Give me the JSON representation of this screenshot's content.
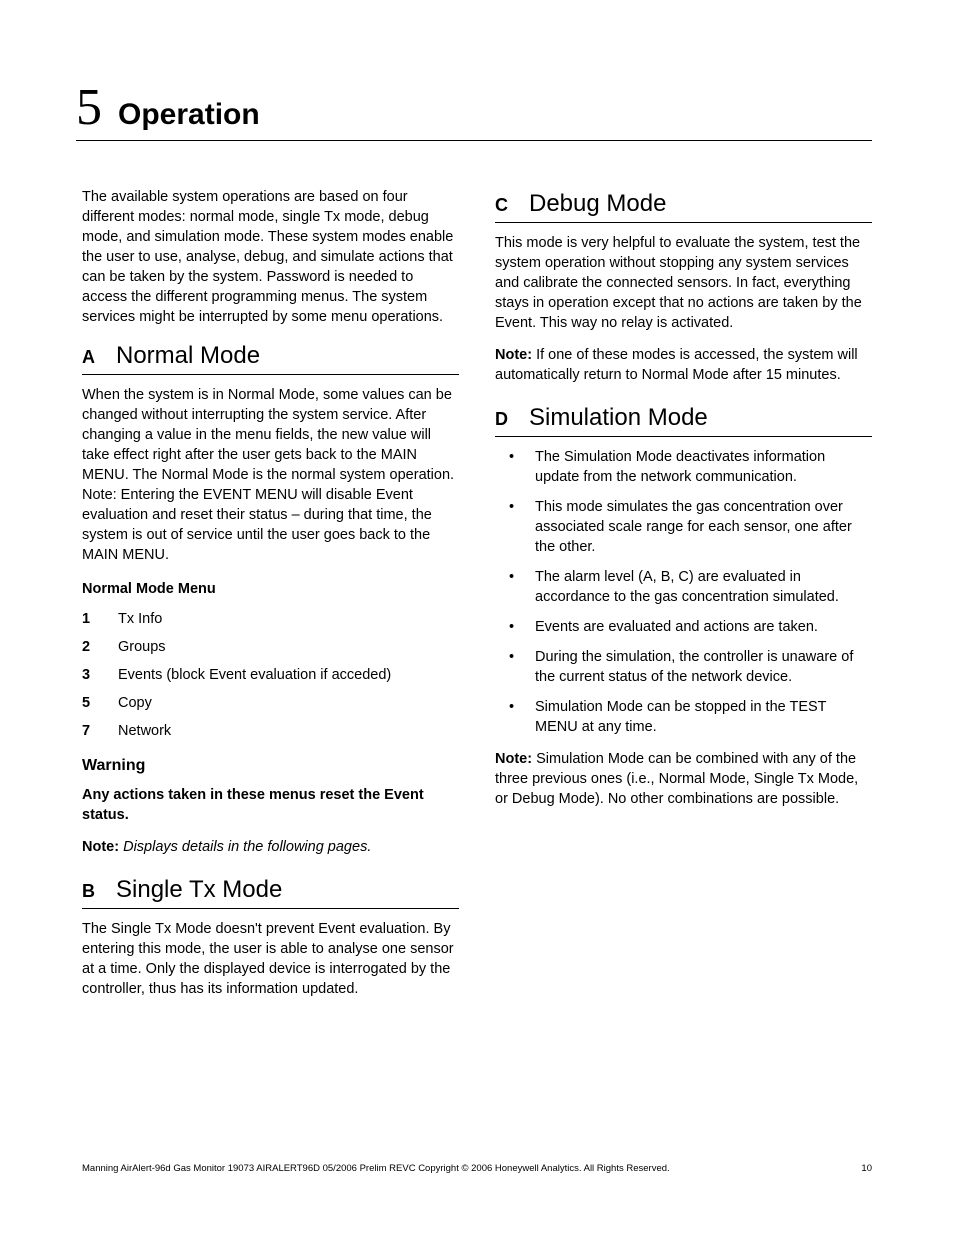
{
  "chapter": {
    "number": "5",
    "title": "Operation"
  },
  "intro": "The available system operations are based on four different modes: normal mode, single Tx mode, debug mode, and simulation mode. These system modes enable the user to use, analyse, debug, and simulate actions that can be taken by the system. Password is needed to access the different programming menus. The system services might be interrupted by some menu operations.",
  "sections": {
    "a": {
      "letter": "A",
      "title": "Normal Mode",
      "body": "When the system is in Normal Mode, some values can be changed without interrupting the system service. After changing a value in the menu fields, the new value will take effect right after the user gets back to the MAIN MENU. The Normal Mode is the normal system operation. Note: Entering the EVENT MENU will disable Event evaluation and reset their status – during that time, the system is out of service until the user goes back to the MAIN MENU.",
      "menu_title": "Normal Mode Menu",
      "menu": [
        {
          "n": "1",
          "label": "Tx Info"
        },
        {
          "n": "2",
          "label": "Groups"
        },
        {
          "n": "3",
          "label": "Events (block Event evaluation if acceded)"
        },
        {
          "n": "5",
          "label": "Copy"
        },
        {
          "n": "7",
          "label": "Network"
        }
      ],
      "warning_head": "Warning",
      "warning_body": "Any actions taken in these menus reset the Event status.",
      "note_label": "Note:",
      "note_body": "Displays details in the following pages."
    },
    "b": {
      "letter": "B",
      "title": "Single Tx Mode",
      "body": "The Single Tx Mode doesn't prevent Event evaluation. By entering this mode, the user is able to analyse one sensor at a time. Only the displayed device is interrogated by the controller, thus has its information updated."
    },
    "c": {
      "letter": "C",
      "title": "Debug Mode",
      "body": "This mode is very helpful to evaluate the system, test the system operation without stopping any system services and calibrate the connected sensors. In fact, everything stays in operation except that no actions are taken by the Event. This way no relay is activated.",
      "note_label": "Note:",
      "note_body": "If one of these modes is accessed, the system will automatically return to Normal Mode after 15 minutes."
    },
    "d": {
      "letter": "D",
      "title": "Simulation Mode",
      "bullets": [
        "The Simulation Mode deactivates information update from the network communication.",
        "This mode simulates the gas concentration over associated scale range for each sensor, one after the other.",
        "The alarm level (A, B, C) are evaluated in accordance to the gas concentration simulated.",
        "Events are evaluated and actions are taken.",
        "During the simulation, the controller is unaware of the current status of the network device.",
        "Simulation Mode can be stopped in the TEST MENU at any time."
      ],
      "note_label": "Note:",
      "note_body": "Simulation Mode can be combined with any of the three previous ones (i.e., Normal Mode, Single Tx Mode, or Debug Mode). No other combinations are possible."
    }
  },
  "footer": {
    "left": "Manning AirAlert-96d Gas Monitor 19073 AIRALERT96D 05/2006 Prelim REVC  Copyright © 2006 Honeywell Analytics. All Rights Reserved.",
    "right": "10"
  }
}
